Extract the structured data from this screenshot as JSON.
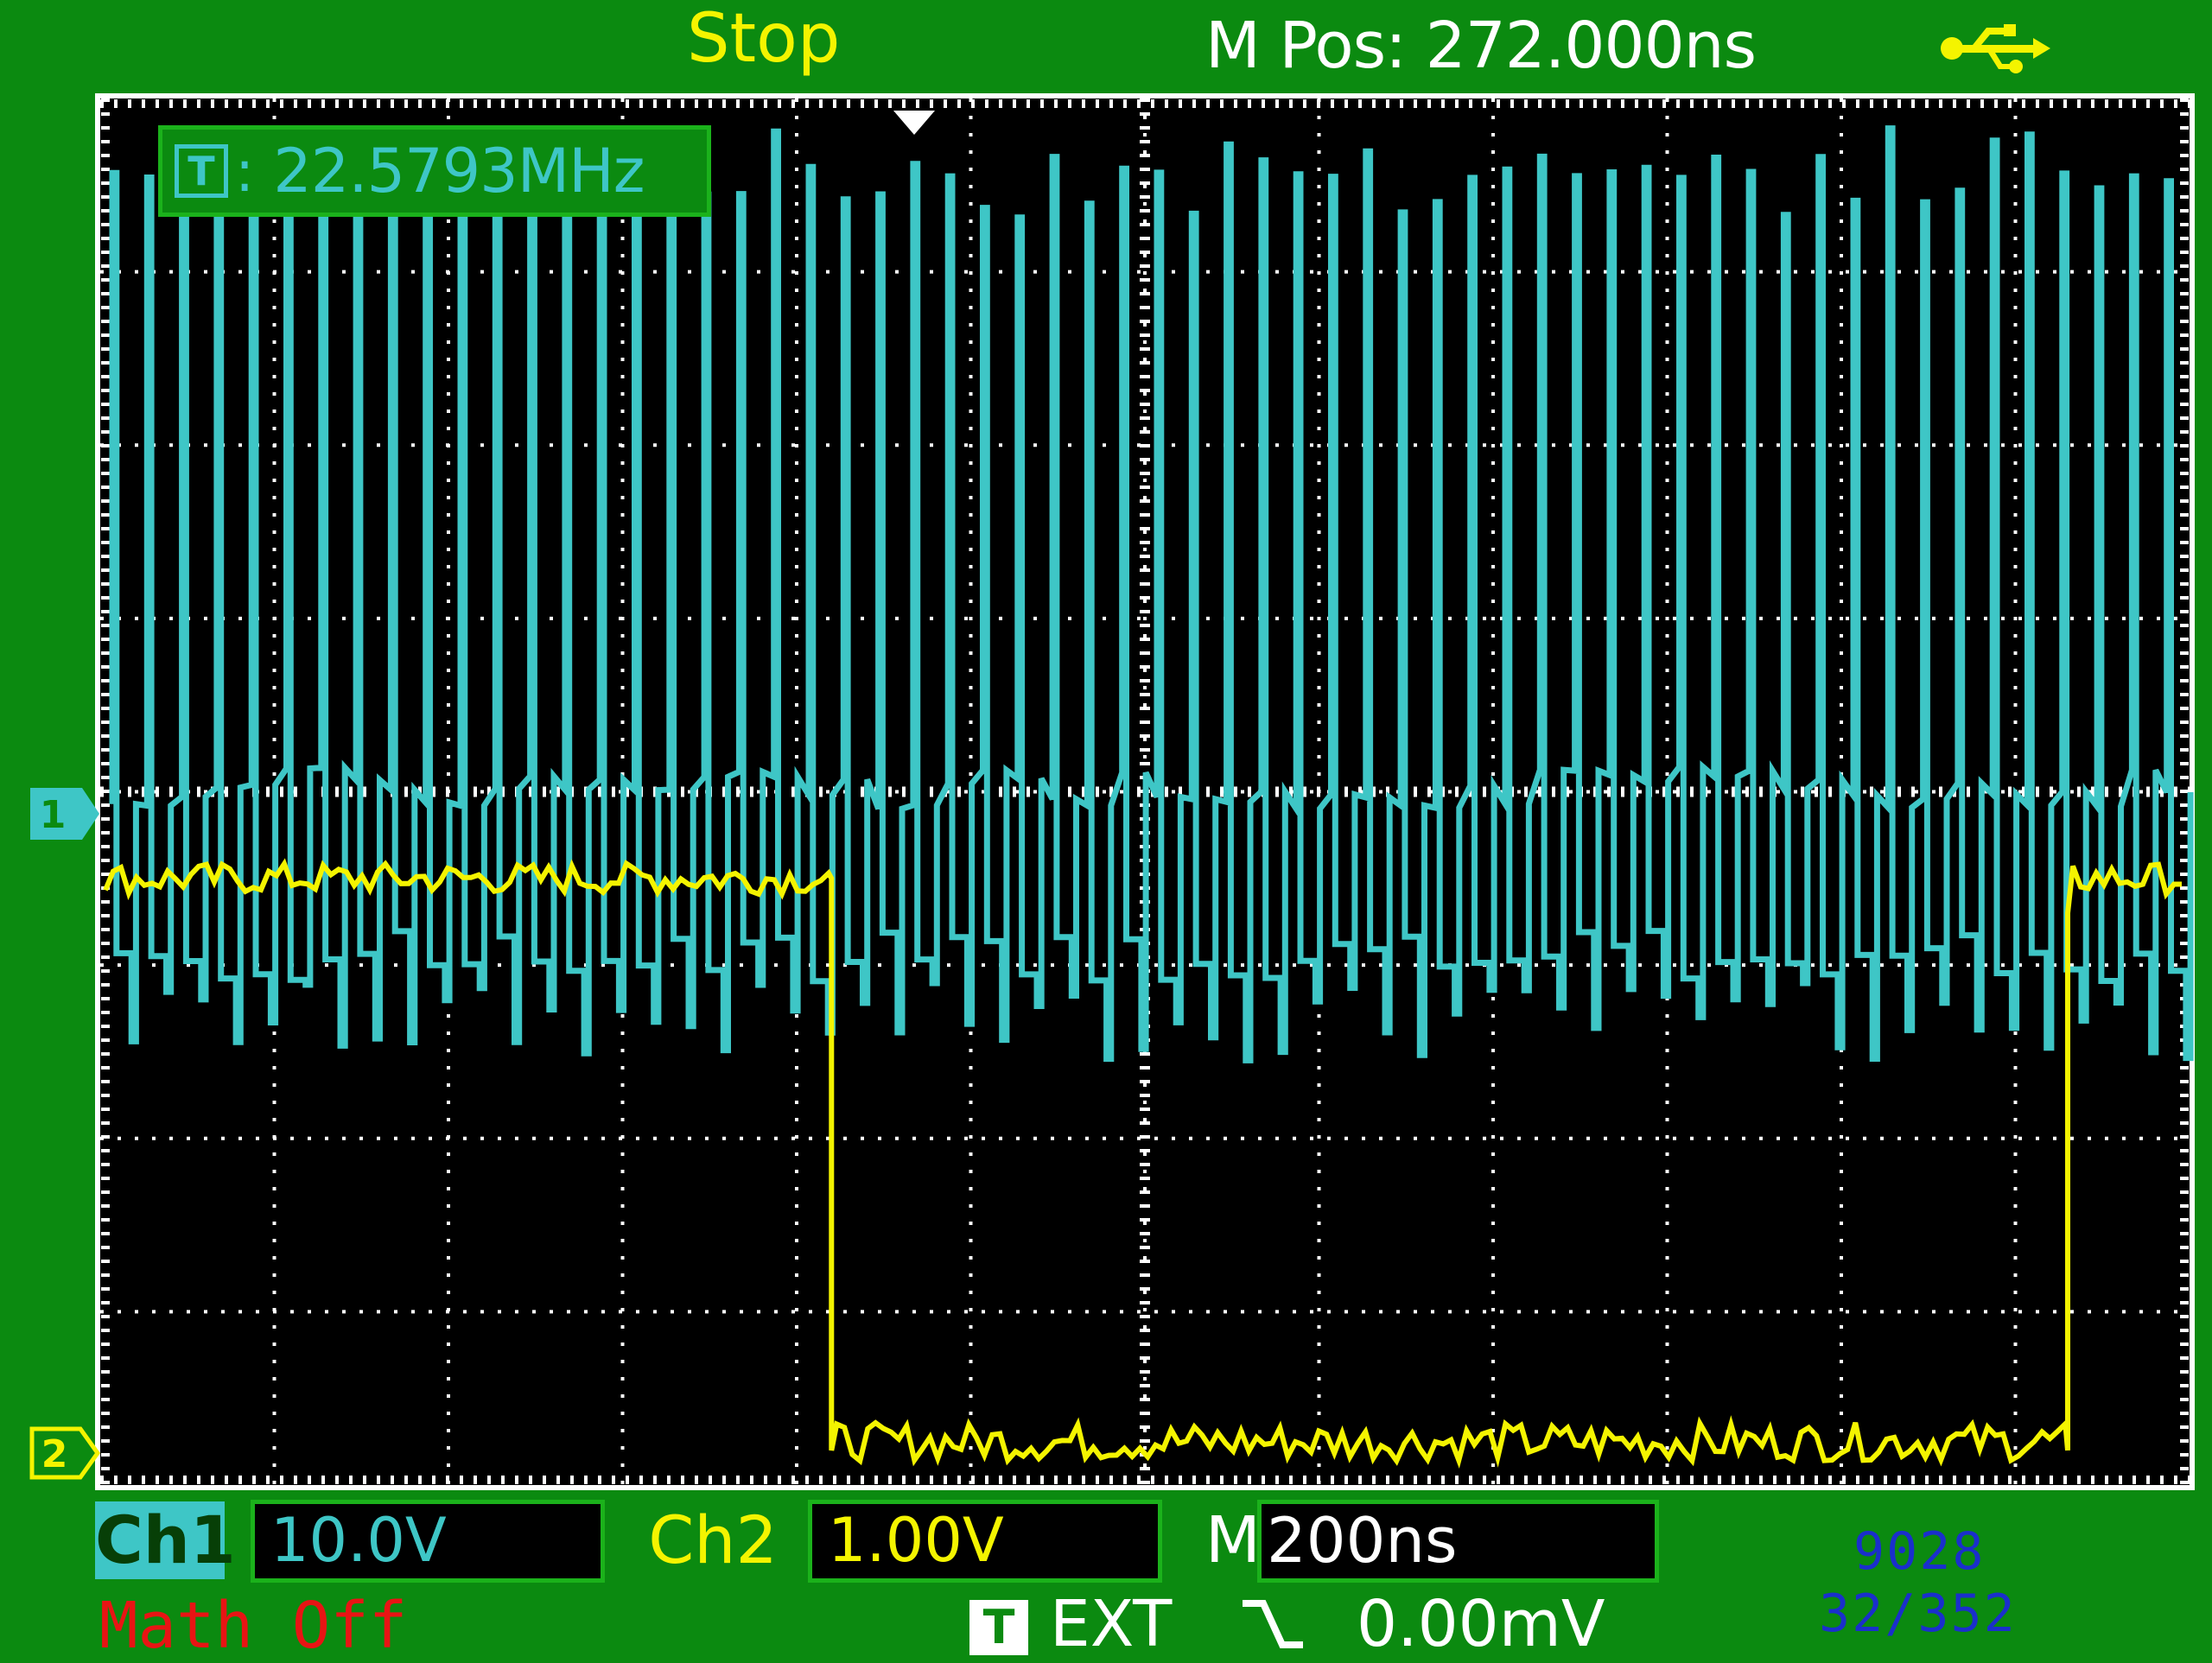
{
  "status": {
    "run_state": "Stop",
    "m_pos": "M Pos: 272.000ns"
  },
  "icons": {
    "usb": "usb-icon",
    "trigger_position": "trigger-position-marker-icon",
    "channel_1_marker": "ch1-ground-marker-icon",
    "channel_2_marker": "ch2-ground-marker-icon",
    "slope": "falling-edge-icon"
  },
  "markers": {
    "ch1": "1",
    "ch2": "2"
  },
  "frequency_readout": {
    "icon_label": "T",
    "separator": ":",
    "value": "22.5793MHz"
  },
  "channels": {
    "ch1": {
      "label": "Ch1",
      "scale": "10.0V",
      "color": "#3ec6c6"
    },
    "ch2": {
      "label": "Ch2",
      "scale": "1.00V",
      "color": "#f4f400"
    }
  },
  "timebase": {
    "label": "M",
    "scale": "200ns"
  },
  "math": {
    "status": "Math Off"
  },
  "trigger": {
    "icon_label": "T",
    "source": "EXT",
    "level": "0.00mV"
  },
  "counters": {
    "line1": "9028",
    "line2": "32/352"
  },
  "colors": {
    "bezel": "#0b8a10",
    "grid": "#ffffff",
    "ch1_trace": "#3ec6c6",
    "ch2_trace": "#f4f400",
    "math_text": "#e81414"
  },
  "chart_data": {
    "type": "line",
    "grid": true,
    "divisions": {
      "x": 12,
      "y": 8
    },
    "series": [
      {
        "name": "Ch1",
        "frequency_mhz": 22.5793,
        "waveform": "clock"
      },
      {
        "name": "Ch2",
        "waveform": "pulse",
        "high_level_div": 3.5,
        "low_level_div": 0.2,
        "falling_edge_div": 4.2,
        "rising_edge_div": 11.3
      }
    ]
  }
}
